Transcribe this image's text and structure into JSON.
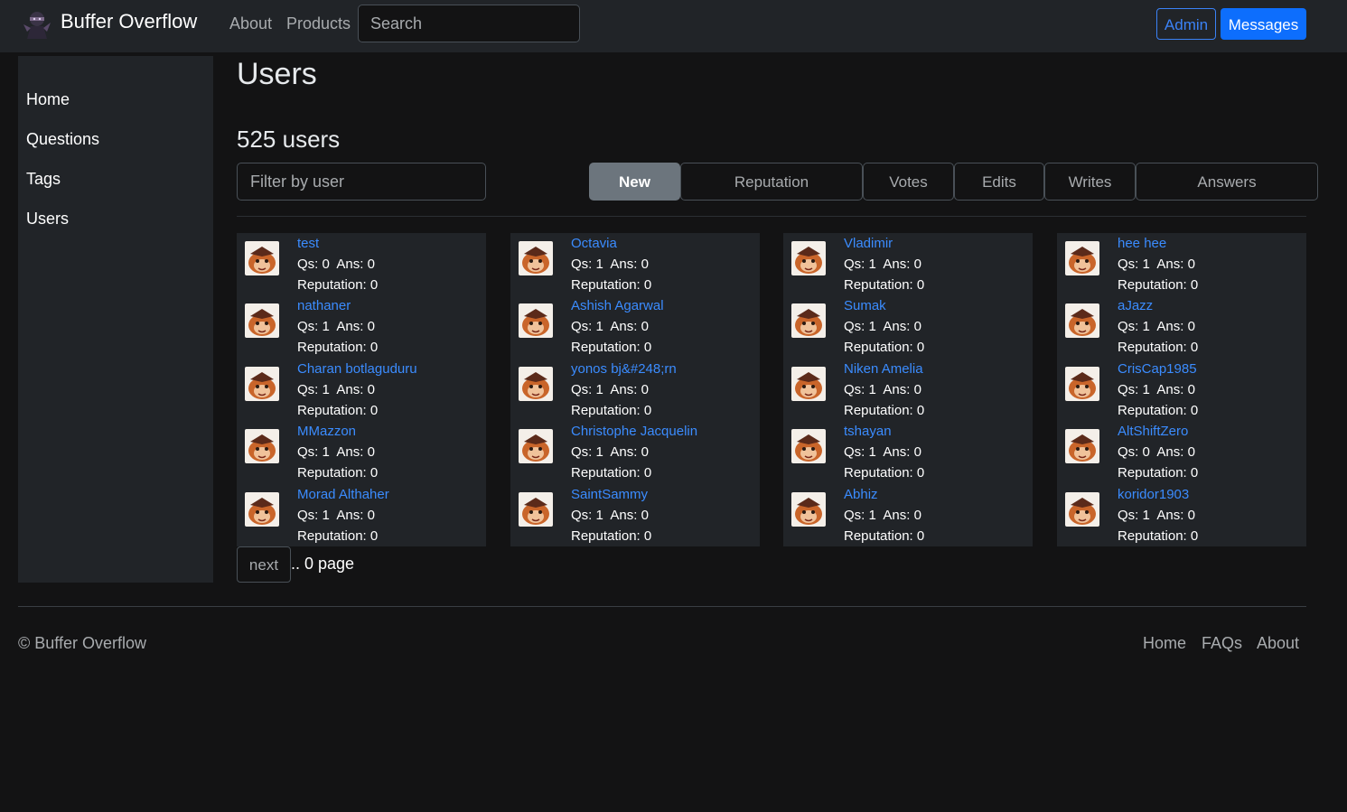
{
  "brand": {
    "name": "Buffer Overflow",
    "logo_icon": "ninja-logo-icon"
  },
  "nav": {
    "about": "About",
    "products": "Products"
  },
  "search": {
    "placeholder": "Search"
  },
  "header_buttons": {
    "admin": "Admin",
    "messages": "Messages"
  },
  "sidebar": {
    "items": [
      "Home",
      "Questions",
      "Tags",
      "Users"
    ]
  },
  "page": {
    "title": "Users",
    "count": "525 users"
  },
  "filter": {
    "placeholder": "Filter by user"
  },
  "tabs": [
    "New",
    "Reputation",
    "Votes",
    "Edits",
    "Writes",
    "Answers"
  ],
  "active_tab": "New",
  "users": [
    [
      {
        "name": "test",
        "qs": "0",
        "ans": "0",
        "rep": "0"
      },
      {
        "name": "nathaner",
        "qs": "1",
        "ans": "0",
        "rep": "0"
      },
      {
        "name": "Charan botlaguduru",
        "qs": "1",
        "ans": "0",
        "rep": "0"
      },
      {
        "name": "MMazzon",
        "qs": "1",
        "ans": "0",
        "rep": "0"
      },
      {
        "name": "Morad Althaher",
        "qs": "1",
        "ans": "0",
        "rep": "0"
      }
    ],
    [
      {
        "name": "Octavia",
        "qs": "1",
        "ans": "0",
        "rep": "0"
      },
      {
        "name": "Ashish Agarwal",
        "qs": "1",
        "ans": "0",
        "rep": "0"
      },
      {
        "name": "yonos bj&#248;rn",
        "qs": "1",
        "ans": "0",
        "rep": "0"
      },
      {
        "name": "Christophe Jacquelin",
        "qs": "1",
        "ans": "0",
        "rep": "0"
      },
      {
        "name": "SaintSammy",
        "qs": "1",
        "ans": "0",
        "rep": "0"
      }
    ],
    [
      {
        "name": "Vladimir",
        "qs": "1",
        "ans": "0",
        "rep": "0"
      },
      {
        "name": "Sumak",
        "qs": "1",
        "ans": "0",
        "rep": "0"
      },
      {
        "name": "Niken Amelia",
        "qs": "1",
        "ans": "0",
        "rep": "0"
      },
      {
        "name": "tshayan",
        "qs": "1",
        "ans": "0",
        "rep": "0"
      },
      {
        "name": "Abhiz",
        "qs": "1",
        "ans": "0",
        "rep": "0"
      }
    ],
    [
      {
        "name": "hee hee",
        "qs": "1",
        "ans": "0",
        "rep": "0"
      },
      {
        "name": "aJazz",
        "qs": "1",
        "ans": "0",
        "rep": "0"
      },
      {
        "name": "CrisCap1985",
        "qs": "1",
        "ans": "0",
        "rep": "0"
      },
      {
        "name": "AltShiftZero",
        "qs": "0",
        "ans": "0",
        "rep": "0"
      },
      {
        "name": "koridor1903",
        "qs": "1",
        "ans": "0",
        "rep": "0"
      }
    ]
  ],
  "labels": {
    "qs": "Qs:",
    "ans": "Ans:",
    "rep": "Reputation:"
  },
  "pagination": {
    "next": "next",
    "info": ".. 0 page"
  },
  "footer": {
    "copyright": "© Buffer Overflow",
    "links": [
      "Home",
      "FAQs",
      "About"
    ]
  },
  "colors": {
    "link": "#3b8cff",
    "primary": "#0d6efd",
    "background": "#131314",
    "panel": "#212428"
  }
}
